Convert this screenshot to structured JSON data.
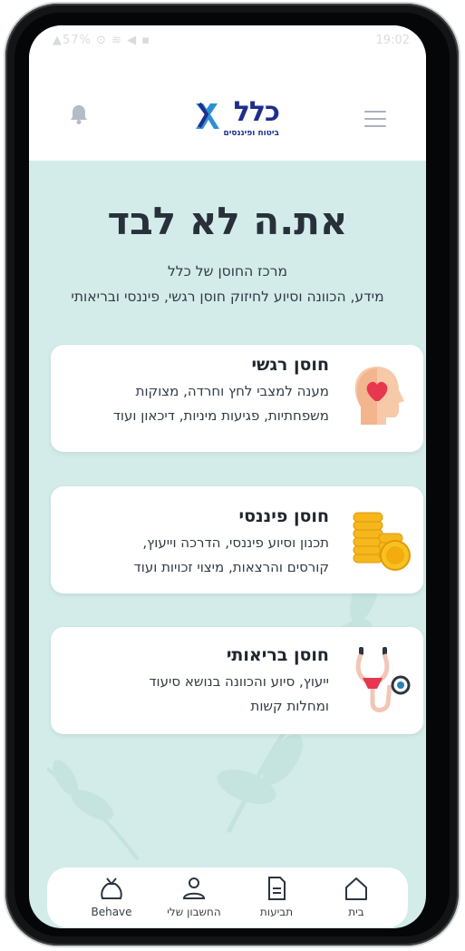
{
  "status_bar": {
    "left": "▲57% ⊙ ≋ ◀ ▪",
    "time": "19:02"
  },
  "header": {
    "logo_word": "כלל",
    "logo_tagline": "ביטוח ופיננסים",
    "bell_icon": "bell-icon",
    "menu_icon": "hamburger-icon"
  },
  "hero": {
    "title": "את.ה לא לבד",
    "subtitle_line1": "מרכז החוסן של כלל",
    "subtitle_line2": "מידע, הכוונה וסיוע לחיזוק חוסן רגשי, פיננסי ובריאותי"
  },
  "cards": [
    {
      "title": "חוסן רגשי",
      "description": "מענה למצבי לחץ וחרדה, מצוקות משפחתיות, פגיעות מיניות, דיכאון ועוד",
      "icon": "head-heart-icon"
    },
    {
      "title": "חוסן פיננסי",
      "description": "תכנון וסיוע פיננסי, הדרכה וייעוץ, קורסים והרצאות, מיצוי זכויות ועוד",
      "icon": "coins-icon"
    },
    {
      "title": "חוסן בריאותי",
      "description": "ייעוץ, סיוע והכוונה בנושא סיעוד ומחלות קשות",
      "icon": "stethoscope-icon"
    }
  ],
  "tabbar": {
    "tabs": [
      {
        "label": "Behave",
        "icon": "behave-bag-icon"
      },
      {
        "label": "החשבון שלי",
        "icon": "user-icon"
      },
      {
        "label": "תביעות",
        "icon": "document-icon"
      },
      {
        "label": "בית",
        "icon": "home-icon"
      }
    ]
  },
  "colors": {
    "background": "#d3ecea",
    "brand": "#1e2f8c",
    "card": "#ffffff"
  }
}
